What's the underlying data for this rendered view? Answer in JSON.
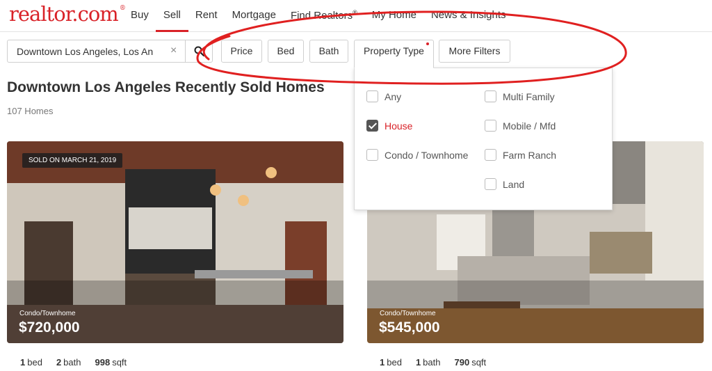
{
  "header": {
    "logo": "realtor.com",
    "logo_mark": "®",
    "nav": [
      "Buy",
      "Sell",
      "Rent",
      "Mortgage",
      "Find Realtors",
      "My Home",
      "News & Insights"
    ],
    "nav_find_realtors_mark": "®",
    "active_nav": "Sell",
    "brand_color": "#d92228"
  },
  "search": {
    "value": "Downtown Los Angeles, Los An",
    "clear_icon": "×"
  },
  "filters": {
    "price": "Price",
    "bed": "Bed",
    "bath": "Bath",
    "property_type": "Property Type",
    "more": "More Filters"
  },
  "results": {
    "title": "Downtown Los Angeles Recently Sold Homes",
    "count": "107 Homes"
  },
  "property_type_options": [
    {
      "label": "Any",
      "checked": false
    },
    {
      "label": "House",
      "checked": true
    },
    {
      "label": "Condo / Townhome",
      "checked": false
    },
    {
      "label": "Multi Family",
      "checked": false
    },
    {
      "label": "Mobile / Mfd",
      "checked": false
    },
    {
      "label": "Farm Ranch",
      "checked": false
    },
    {
      "label": "Land",
      "checked": false
    }
  ],
  "listings": [
    {
      "badge": "SOLD ON MARCH 21, 2019",
      "type": "Condo/Townhome",
      "price": "$720,000",
      "beds": "1",
      "bed_label": "bed",
      "baths": "2",
      "bath_label": "bath",
      "sqft": "998",
      "sqft_label": "sqft"
    },
    {
      "type": "Condo/Townhome",
      "price": "$545,000",
      "beds": "1",
      "bed_label": "bed",
      "baths": "1",
      "bath_label": "bath",
      "sqft": "790",
      "sqft_label": "sqft"
    }
  ]
}
